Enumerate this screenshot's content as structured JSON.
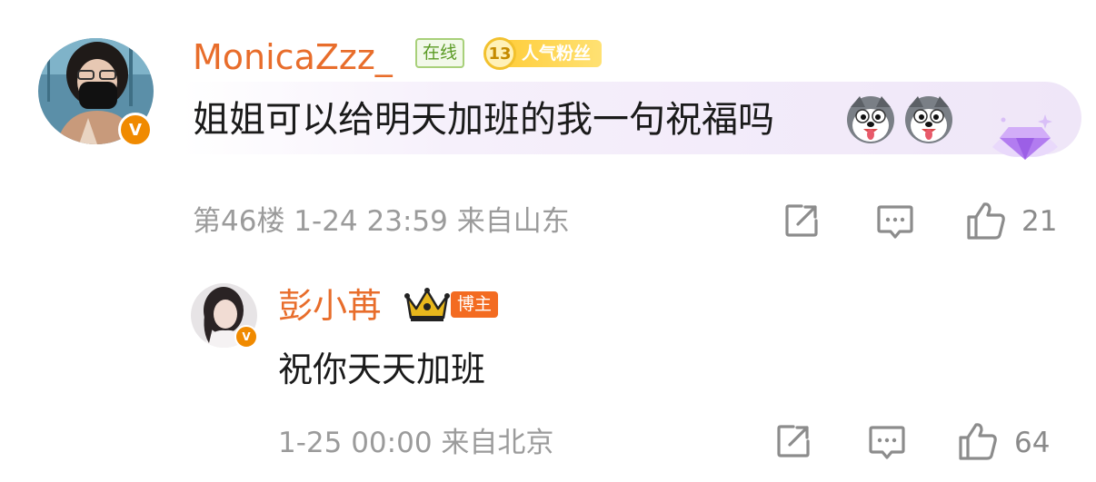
{
  "comment": {
    "author": "MonicaZzz_",
    "online_tag": "在线",
    "fan_level": "13",
    "fan_label": "人气粉丝",
    "text": "姐姐可以给明天加班的我一句祝福吗",
    "emojis": [
      "husky-dog-emoji",
      "husky-dog-emoji"
    ],
    "meta": "第46楼 1-24 23:59 来自山东",
    "likes": "21",
    "verified_badge": "V"
  },
  "reply": {
    "author": "彭小苒",
    "blogger_tag": "博主",
    "text": "祝你天天加班",
    "meta": "1-25 00:00 来自北京",
    "likes": "64",
    "verified_badge": "V"
  },
  "icons": {
    "share": "share-icon",
    "reply": "comment-icon",
    "like": "thumbs-up-icon",
    "crown": "crown-icon",
    "diamond": "diamond-badge-icon"
  },
  "colors": {
    "name": "#e86d2b",
    "verified": "#f08a00",
    "blogger": "#f36b21",
    "online_border": "#a8d07a",
    "meta": "#9b9b9b"
  }
}
